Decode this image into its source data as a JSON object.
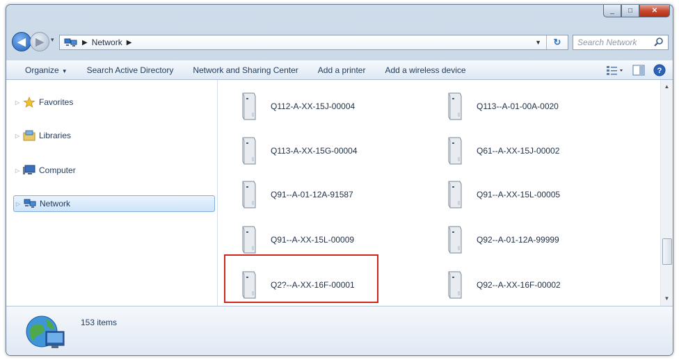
{
  "window": {
    "caption_buttons": {
      "minimize": "_",
      "maximize": "□",
      "close": "✕"
    }
  },
  "address_bar": {
    "breadcrumb": [
      "Network"
    ],
    "search_placeholder": "Search Network"
  },
  "toolbar": {
    "organize": "Organize",
    "search_ad": "Search Active Directory",
    "network_sharing": "Network and Sharing Center",
    "add_printer": "Add a printer",
    "add_wireless": "Add a wireless device"
  },
  "nav_pane": {
    "items": [
      {
        "label": "Favorites",
        "icon": "star-icon",
        "selected": false
      },
      {
        "label": "Libraries",
        "icon": "library-icon",
        "selected": false
      },
      {
        "label": "Computer",
        "icon": "computer-icon",
        "selected": false
      },
      {
        "label": "Network",
        "icon": "network-icon",
        "selected": true
      }
    ]
  },
  "files": {
    "items": [
      "Q112-A-XX-15J-00004",
      "Q113--A-01-00A-0020",
      "Q113-A-XX-15G-00004",
      "Q61--A-XX-15J-00002",
      "Q91--A-01-12A-91587",
      "Q91--A-XX-15L-00005",
      "Q91--A-XX-15L-00009",
      "Q92--A-01-12A-99999",
      "Q2?--A-XX-16F-00001",
      "Q92--A-XX-16F-00002"
    ],
    "highlighted_index": 8
  },
  "details": {
    "item_count": "153 items"
  },
  "colors": {
    "highlight": "#d0231d",
    "selection": "#cde4fa",
    "toolbar_bg": "#dde8f4"
  }
}
